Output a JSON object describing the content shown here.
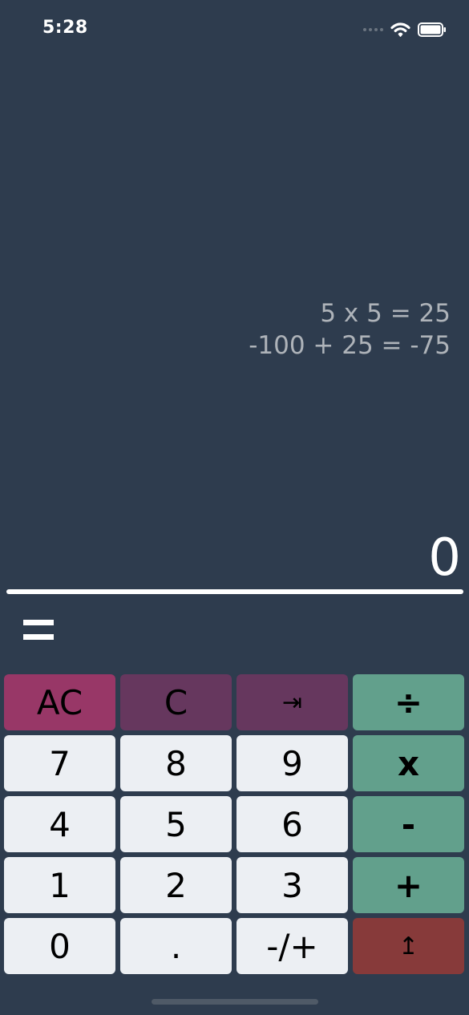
{
  "status_bar": {
    "time": "5:28",
    "icons": [
      "signal-dots-icon",
      "wifi-icon",
      "battery-icon"
    ]
  },
  "history": {
    "lines": [
      "5 x 5 = 25",
      "-100 + 25 = -75"
    ]
  },
  "display": {
    "value": "0",
    "equals_symbol": "="
  },
  "keypad": {
    "rows": [
      [
        "AC",
        "C",
        "⇥",
        "÷"
      ],
      [
        "7",
        "8",
        "9",
        "x"
      ],
      [
        "4",
        "5",
        "6",
        "-"
      ],
      [
        "1",
        "2",
        "3",
        "+"
      ],
      [
        "0",
        ".",
        "-/+",
        "↥"
      ]
    ]
  },
  "colors": {
    "background": "#2e3c4e",
    "number_key": "#eceff3",
    "operator_key": "#62a08c",
    "ac_key": "#983767",
    "function_key": "#66375e",
    "enter_key": "#873a3a"
  }
}
